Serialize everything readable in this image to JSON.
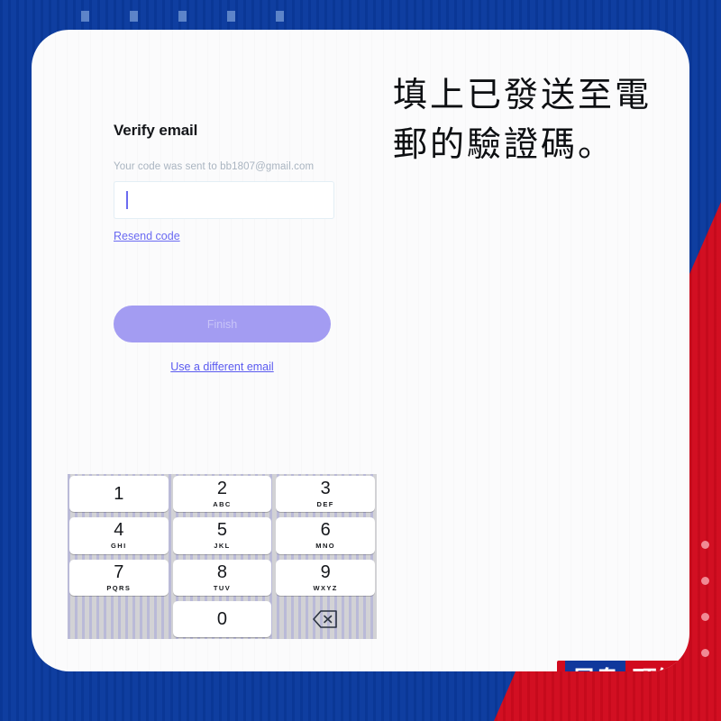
{
  "background": {
    "blue_hex": "#0a3a9e",
    "red_hex": "#d10a1e",
    "card_hex": "#fbfbfc",
    "top_dots_count": 5,
    "right_dots_count": 4
  },
  "form": {
    "title": "Verify email",
    "subtitle": "Your code was sent to bb1807@gmail.com",
    "code_input": {
      "value": "",
      "placeholder": ""
    },
    "resend_label": "Resend code",
    "finish_label": "Finish",
    "finish_color_hex": "#a39cf2",
    "alt_email_label": "Use a different email",
    "link_color_hex": "#5a5af0"
  },
  "keypad": {
    "keys": [
      {
        "digit": "1",
        "letters": ""
      },
      {
        "digit": "2",
        "letters": "ABC"
      },
      {
        "digit": "3",
        "letters": "DEF"
      },
      {
        "digit": "4",
        "letters": "GHI"
      },
      {
        "digit": "5",
        "letters": "JKL"
      },
      {
        "digit": "6",
        "letters": "MNO"
      },
      {
        "digit": "7",
        "letters": "PQRS"
      },
      {
        "digit": "8",
        "letters": "TUV"
      },
      {
        "digit": "9",
        "letters": "WXYZ"
      },
      {
        "digit": "",
        "letters": ""
      },
      {
        "digit": "0",
        "letters": ""
      },
      {
        "digit": "backspace-icon",
        "letters": ""
      }
    ]
  },
  "caption": {
    "text": "填上已發送至電郵的驗證碼。"
  },
  "logo": {
    "left_text": "星島",
    "right_text": "頭條"
  }
}
